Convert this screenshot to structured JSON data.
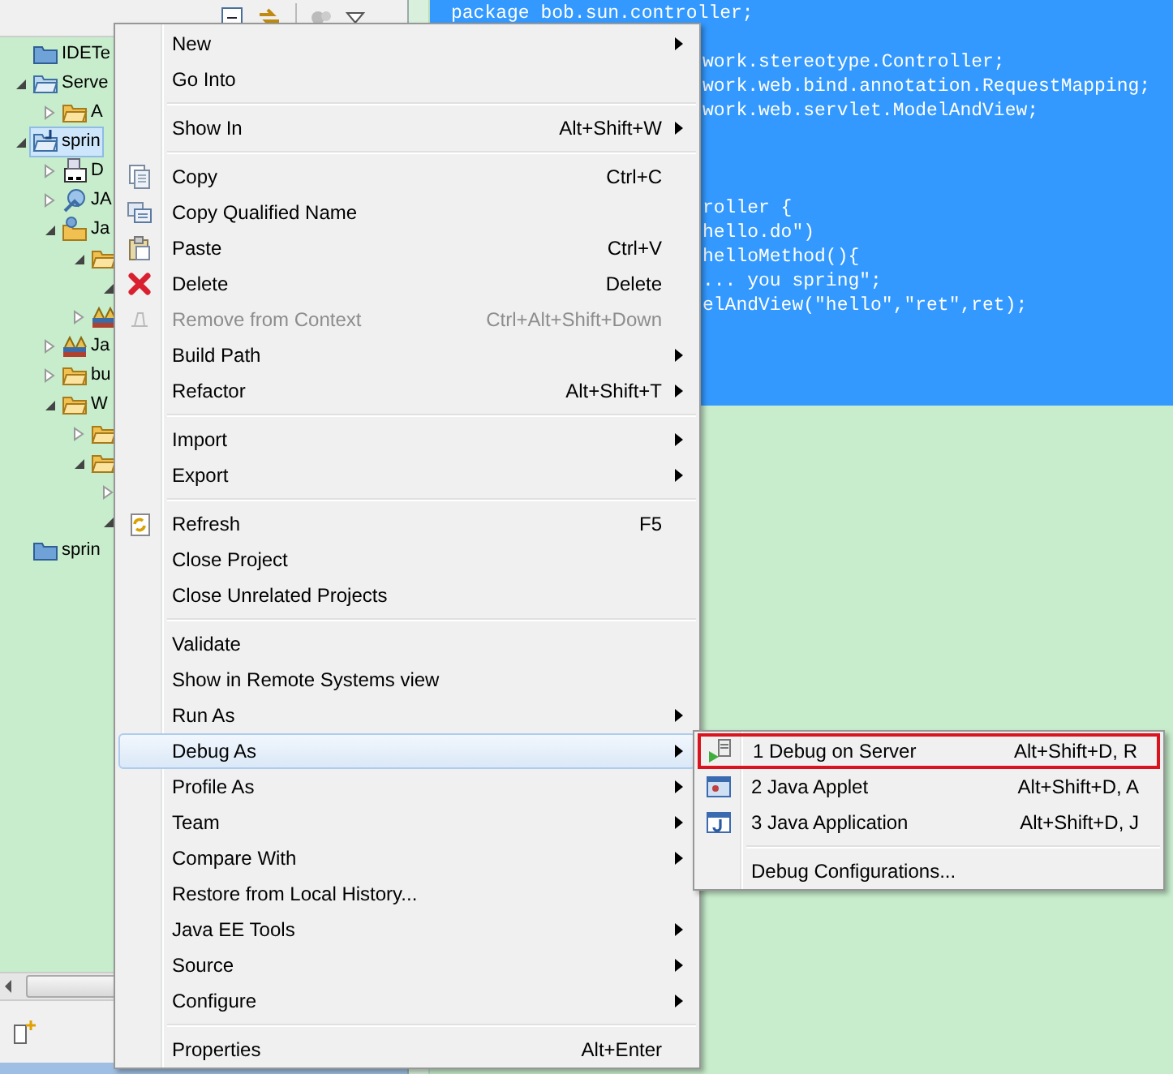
{
  "explorer": {
    "tree": [
      {
        "kind": "project-closed",
        "label": "IDETe",
        "selected": false
      },
      {
        "kind": "server",
        "label": "Serve",
        "expanded": true,
        "selected": false,
        "children": [
          {
            "kind": "folder",
            "label": "A",
            "expanded": false,
            "selected": false
          }
        ]
      },
      {
        "kind": "project",
        "label": "sprin",
        "expanded": true,
        "selected": true,
        "children": [
          {
            "kind": "descriptor",
            "label": "D",
            "expanded": false,
            "selected": false
          },
          {
            "kind": "webservice",
            "label": "JA",
            "expanded": false,
            "selected": false
          },
          {
            "kind": "resources",
            "label": "Ja",
            "expanded": true,
            "selected": false,
            "children": [
              {
                "kind": "folder",
                "expanded": true,
                "selected": false,
                "children": [
                  {
                    "expanded": true,
                    "selected": false
                  }
                ]
              },
              {
                "kind": "library",
                "expanded": false,
                "selected": false
              }
            ]
          },
          {
            "kind": "library",
            "label": "Ja",
            "expanded": false,
            "selected": false
          },
          {
            "kind": "folder",
            "label": "bu",
            "expanded": false,
            "selected": false
          },
          {
            "kind": "folder",
            "label": "W",
            "expanded": true,
            "selected": false,
            "children": [
              {
                "kind": "folder",
                "expanded": false,
                "selected": false
              },
              {
                "kind": "folder",
                "expanded": true,
                "selected": false,
                "children": [
                  {
                    "expanded": false,
                    "selected": false
                  },
                  {
                    "expanded": true,
                    "selected": false
                  }
                ]
              }
            ]
          }
        ]
      },
      {
        "kind": "project-closed",
        "label": "sprin",
        "selected": false
      }
    ]
  },
  "editor": {
    "lines": [
      {
        "kind": "code",
        "text": "package bob.sun.controller;"
      },
      {
        "kind": "blank"
      },
      {
        "kind": "clipped",
        "text": "work.stereotype.Controller;"
      },
      {
        "kind": "clipped",
        "text": "work.web.bind.annotation.RequestMapping;"
      },
      {
        "kind": "clipped",
        "text": "work.web.servlet.ModelAndView;"
      },
      {
        "kind": "blank"
      },
      {
        "kind": "blank"
      },
      {
        "kind": "blank"
      },
      {
        "kind": "clipped",
        "text": "roller {"
      },
      {
        "kind": "clipped",
        "text": "hello.do\")"
      },
      {
        "kind": "clipped",
        "text": "helloMethod(){"
      },
      {
        "kind": "clipped",
        "text": "... you spring\";"
      },
      {
        "kind": "clipped",
        "text": "elAndView(\"hello\",\"ret\",ret);"
      }
    ]
  },
  "context_menu": {
    "items": [
      {
        "kind": "item",
        "label": "New",
        "submenu": true,
        "disabled": false,
        "selected": false
      },
      {
        "kind": "item",
        "label": "Go Into",
        "submenu": false,
        "disabled": false,
        "selected": false
      },
      {
        "kind": "separator"
      },
      {
        "kind": "item",
        "label": "Show In",
        "shortcut": "Alt+Shift+W",
        "submenu": true,
        "disabled": false,
        "selected": false
      },
      {
        "kind": "separator"
      },
      {
        "kind": "item",
        "label": "Copy",
        "shortcut": "Ctrl+C",
        "submenu": false,
        "disabled": false,
        "selected": false
      },
      {
        "kind": "item",
        "label": "Copy Qualified Name",
        "submenu": false,
        "disabled": false,
        "selected": false
      },
      {
        "kind": "item",
        "label": "Paste",
        "shortcut": "Ctrl+V",
        "submenu": false,
        "disabled": false,
        "selected": false
      },
      {
        "kind": "item",
        "label": "Delete",
        "shortcut": "Delete",
        "submenu": false,
        "disabled": false,
        "selected": false
      },
      {
        "kind": "item",
        "label": "Remove from Context",
        "shortcut": "Ctrl+Alt+Shift+Down",
        "submenu": false,
        "disabled": true,
        "selected": false
      },
      {
        "kind": "item",
        "label": "Build Path",
        "submenu": true,
        "disabled": false,
        "selected": false
      },
      {
        "kind": "item",
        "label": "Refactor",
        "shortcut": "Alt+Shift+T",
        "submenu": true,
        "disabled": false,
        "selected": false
      },
      {
        "kind": "separator"
      },
      {
        "kind": "item",
        "label": "Import",
        "submenu": true,
        "disabled": false,
        "selected": false
      },
      {
        "kind": "item",
        "label": "Export",
        "submenu": true,
        "disabled": false,
        "selected": false
      },
      {
        "kind": "separator"
      },
      {
        "kind": "item",
        "label": "Refresh",
        "shortcut": "F5",
        "submenu": false,
        "disabled": false,
        "selected": false
      },
      {
        "kind": "item",
        "label": "Close Project",
        "submenu": false,
        "disabled": false,
        "selected": false
      },
      {
        "kind": "item",
        "label": "Close Unrelated Projects",
        "submenu": false,
        "disabled": false,
        "selected": false
      },
      {
        "kind": "separator"
      },
      {
        "kind": "item",
        "label": "Validate",
        "submenu": false,
        "disabled": false,
        "selected": false
      },
      {
        "kind": "item",
        "label": "Show in Remote Systems view",
        "submenu": false,
        "disabled": false,
        "selected": false
      },
      {
        "kind": "item",
        "label": "Run As",
        "submenu": true,
        "disabled": false,
        "selected": false
      },
      {
        "kind": "item",
        "label": "Debug As",
        "submenu": true,
        "disabled": false,
        "selected": true
      },
      {
        "kind": "item",
        "label": "Profile As",
        "submenu": true,
        "disabled": false,
        "selected": false
      },
      {
        "kind": "item",
        "label": "Team",
        "submenu": true,
        "disabled": false,
        "selected": false
      },
      {
        "kind": "item",
        "label": "Compare With",
        "submenu": true,
        "disabled": false,
        "selected": false
      },
      {
        "kind": "item",
        "label": "Restore from Local History...",
        "submenu": false,
        "disabled": false,
        "selected": false
      },
      {
        "kind": "item",
        "label": "Java EE Tools",
        "submenu": true,
        "disabled": false,
        "selected": false
      },
      {
        "kind": "item",
        "label": "Source",
        "submenu": true,
        "disabled": false,
        "selected": false
      },
      {
        "kind": "item",
        "label": "Configure",
        "submenu": true,
        "disabled": false,
        "selected": false
      },
      {
        "kind": "separator"
      },
      {
        "kind": "item",
        "label": "Properties",
        "shortcut": "Alt+Enter",
        "submenu": false,
        "disabled": false,
        "selected": false
      }
    ]
  },
  "submenu": {
    "items": [
      {
        "kind": "item",
        "label": "1 Debug on Server",
        "shortcut": "Alt+Shift+D, R",
        "submenu": false,
        "disabled": false,
        "selected": true
      },
      {
        "kind": "item",
        "label": "2 Java Applet",
        "shortcut": "Alt+Shift+D, A",
        "submenu": false,
        "disabled": false,
        "selected": false
      },
      {
        "kind": "item",
        "label": "3 Java Application",
        "shortcut": "Alt+Shift+D, J",
        "submenu": false,
        "disabled": false,
        "selected": false
      },
      {
        "kind": "separator"
      },
      {
        "kind": "item",
        "label": "Debug Configurations...",
        "submenu": false,
        "disabled": false,
        "selected": false
      }
    ]
  }
}
